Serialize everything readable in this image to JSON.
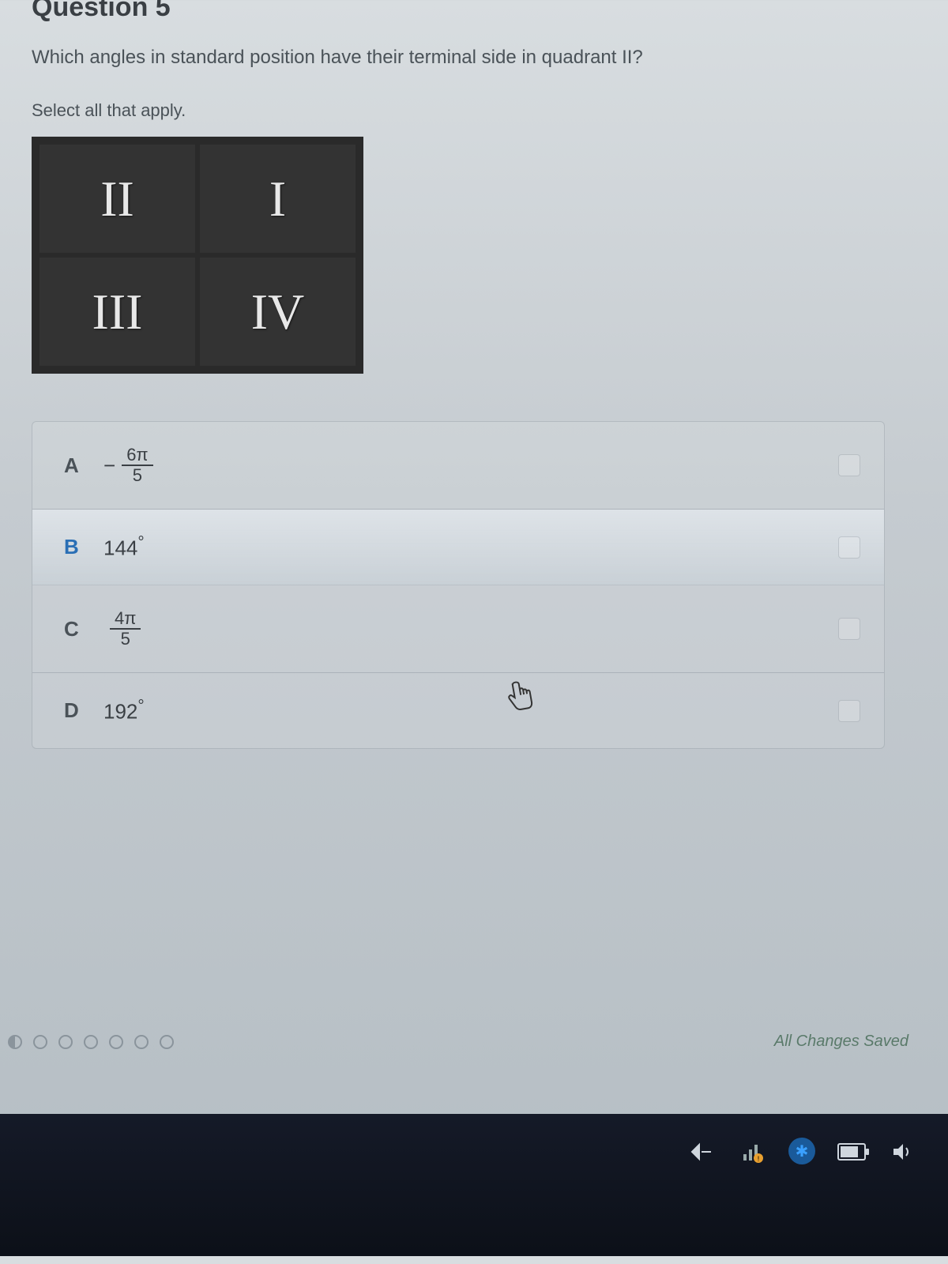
{
  "question_header": "Question 5",
  "prompt": "Which angles in standard position have their terminal side in quadrant II?",
  "instruction": "Select all that apply.",
  "quadrants": {
    "tl": "II",
    "tr": "I",
    "bl": "III",
    "br": "IV"
  },
  "answers": [
    {
      "letter": "A",
      "type": "fraction",
      "sign": "−",
      "num": "6π",
      "den": "5"
    },
    {
      "letter": "B",
      "type": "degree",
      "value": "144",
      "hover": true
    },
    {
      "letter": "C",
      "type": "fraction",
      "sign": "",
      "num": "4π",
      "den": "5"
    },
    {
      "letter": "D",
      "type": "degree",
      "value": "192"
    }
  ],
  "save_status": "All Changes Saved",
  "tray": {
    "bluetooth": "✱"
  }
}
